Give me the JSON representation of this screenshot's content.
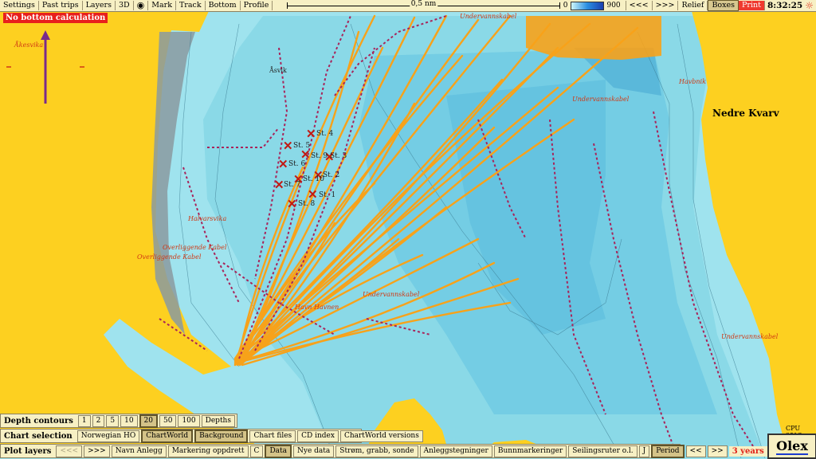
{
  "toolbar": {
    "items": [
      "Settings",
      "Past trips",
      "Layers",
      "3D",
      "Mark",
      "Track",
      "Bottom",
      "Profile"
    ],
    "scale_label": "0,5 nm",
    "depth_min": "0",
    "depth_max": "900",
    "nav_back": "<<<",
    "nav_fwd": ">>>",
    "relief": "Relief",
    "boxes": "Boxes",
    "print": "Print",
    "clock": "8:32:25"
  },
  "alert": "No bottom calculation",
  "map_labels": {
    "aksvika": "Åkesvika",
    "asvik": "Åsvik",
    "undervannskabel_top": "Undervannskabel",
    "undervannskabel_mid": "Undervannskabel",
    "undervannskabel_center": "Undervannskabel",
    "undervannskabel_right": "Undervannskabel",
    "havnik": "Havbnik",
    "nedre_kvarv": "Nedre Kvarv",
    "halvarsvika": "Halvarsvika",
    "overliggende_kabel": "Overliggende Kabel",
    "overliggende_kabel2": "Overliggende Kabel",
    "havn": "Havn Havnen"
  },
  "stations": [
    "St. 4",
    "St. 5",
    "St. 3",
    "St. 6",
    "St. 2",
    "St. 10",
    "St. 7",
    "St. 1",
    "St. 8",
    "St. 9"
  ],
  "depth_contours": {
    "label": "Depth contours",
    "options": [
      "1",
      "2",
      "5",
      "10",
      "20",
      "50",
      "100",
      "Depths"
    ],
    "selected": "20"
  },
  "chart_selection": {
    "label": "Chart selection",
    "options": [
      "Norwegian HO",
      "ChartWorld",
      "Background",
      "Chart files",
      "CD index",
      "ChartWorld versions"
    ],
    "selected": [
      "ChartWorld",
      "Background"
    ]
  },
  "plot_layers": {
    "label": "Plot layers",
    "back": "<<<",
    "fwd": ">>>",
    "options": [
      "Navn Anlegg",
      "Markering oppdrett",
      "C",
      "Data",
      "Nye data",
      "Strøm, grabb, sonde",
      "Anleggstegninger",
      "Bunnmarkeringer",
      "Seilingsruter o.l.",
      "J"
    ],
    "selected": "Data",
    "period": "Period",
    "prev": "<<",
    "next": ">>",
    "years": "3 years"
  },
  "cpu": "CPU 35°C",
  "brand": "Olex",
  "colors": {
    "land": "#fdd020",
    "water_shallow": "#b8f0f4",
    "water_mid": "#8fdfea",
    "water_deep": "#6fcde6",
    "track_orange": "#f7a21a",
    "track_maroon": "#a8245a",
    "station_marker": "#c11a14"
  }
}
